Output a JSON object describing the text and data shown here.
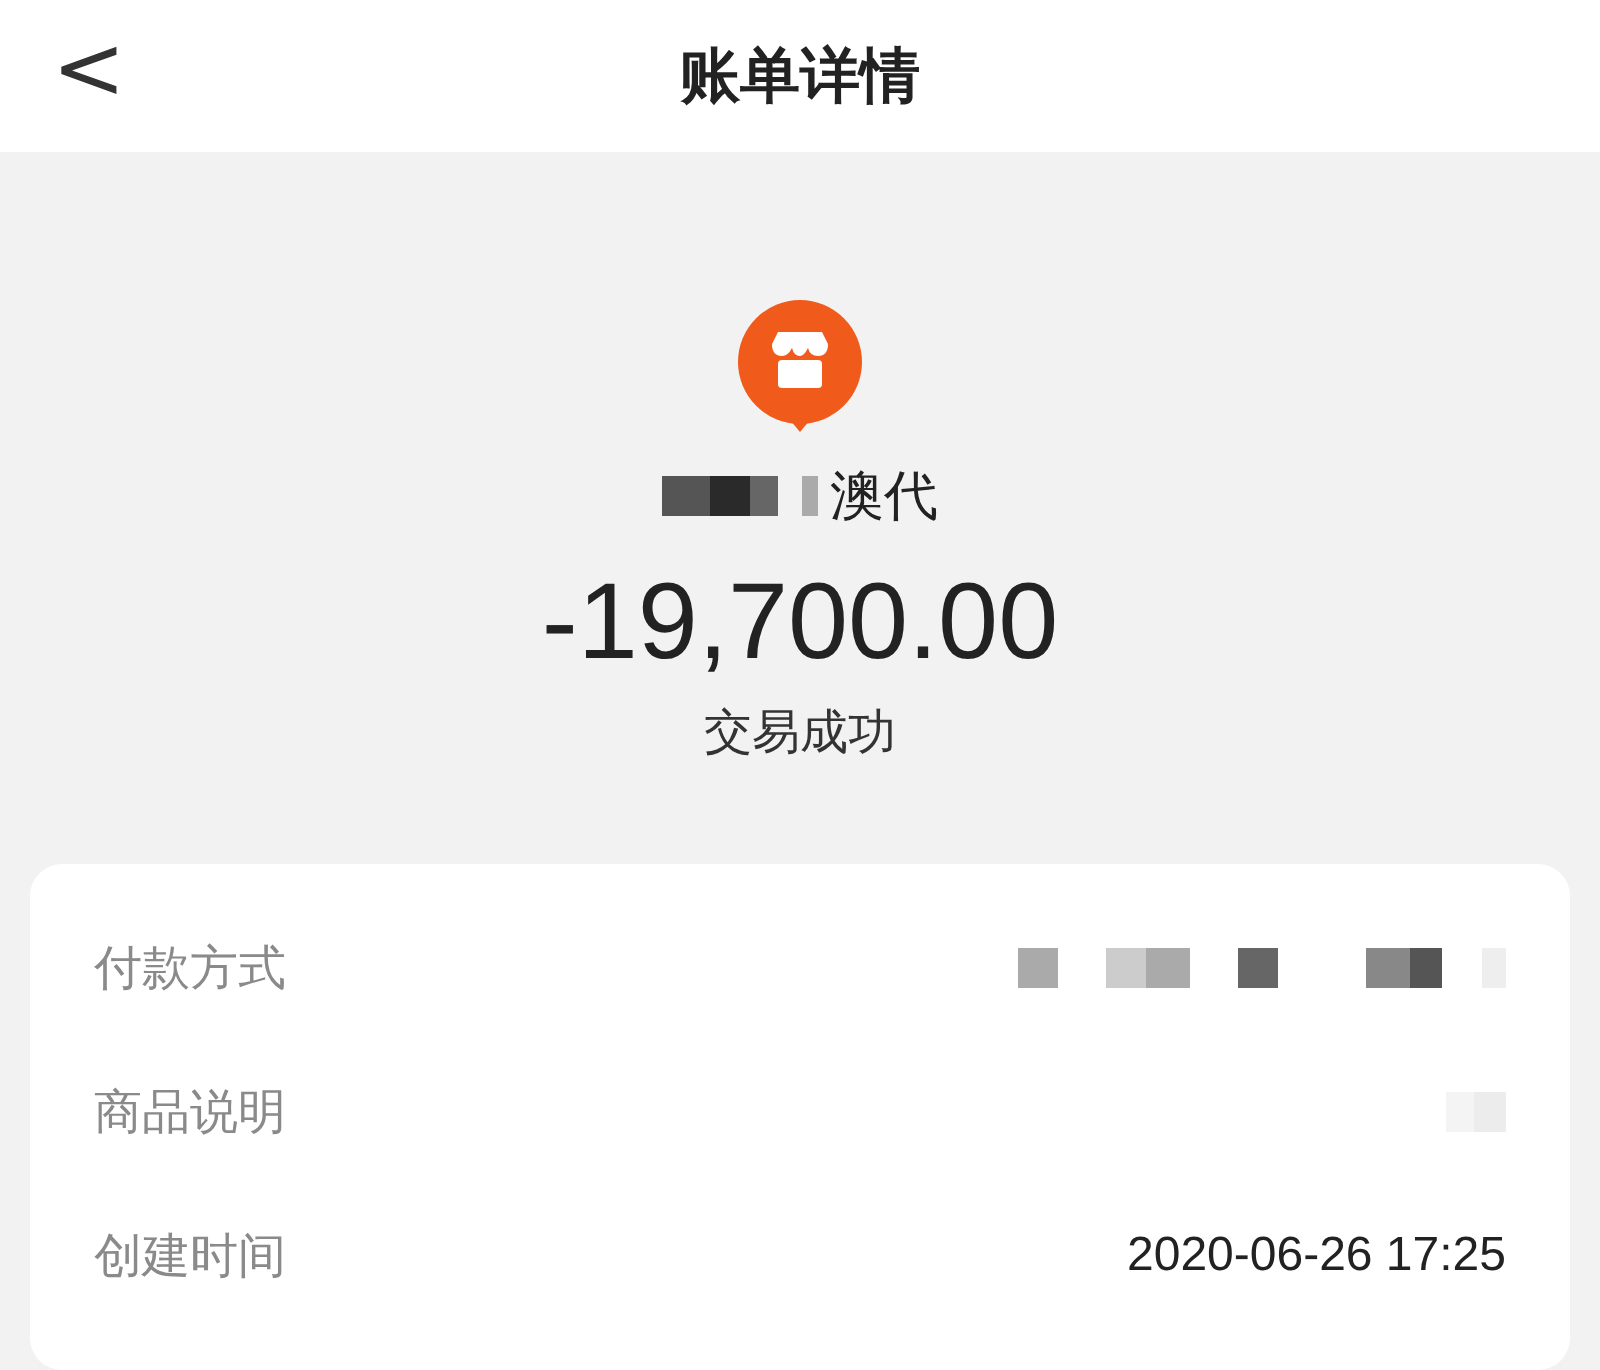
{
  "header": {
    "back": "<",
    "title": "账单详情"
  },
  "merchant": {
    "name_visible": "澳代",
    "redacted_prefix": true
  },
  "amount": "-19,700.00",
  "status": "交易成功",
  "details": [
    {
      "label": "付款方式",
      "kind": "redacted"
    },
    {
      "label": "商品说明",
      "kind": "faint"
    },
    {
      "label": "创建时间",
      "kind": "text",
      "value": "2020-06-26 17:25"
    }
  ]
}
